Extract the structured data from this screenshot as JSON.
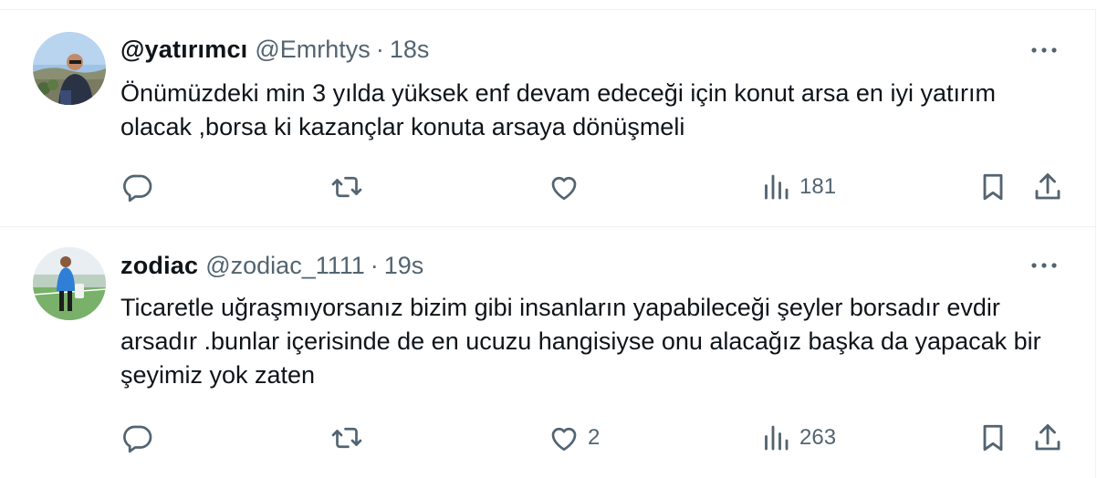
{
  "tweets": [
    {
      "display_name": "@yatırımcı",
      "handle": "@Emrhtys",
      "separator": "·",
      "time": "18s",
      "text": "Önümüzdeki min 3 yılda yüksek enf devam edeceği için konut arsa en iyi yatırım olacak ,borsa ki kazançlar konuta arsaya dönüşmeli",
      "likes": "",
      "views": "181"
    },
    {
      "display_name": "zodiac",
      "handle": "@zodiac_1111",
      "separator": "·",
      "time": "19s",
      "text": "Ticaretle uğraşmıyorsanız bizim gibi insanların yapabileceği şeyler borsadır evdir arsadır .bunlar içerisinde de en ucuzu hangisiyse onu alacağız başka da yapacak bir şeyimiz yok zaten",
      "likes": "2",
      "views": "263"
    }
  ],
  "icons": {
    "reply": "reply-icon",
    "repost": "repost-icon",
    "like": "heart-icon",
    "views": "views-icon",
    "bookmark": "bookmark-icon",
    "share": "share-icon",
    "more": "more-icon"
  },
  "colors": {
    "text": "#0f1419",
    "secondary": "#536471",
    "divider": "#eff3f4"
  }
}
